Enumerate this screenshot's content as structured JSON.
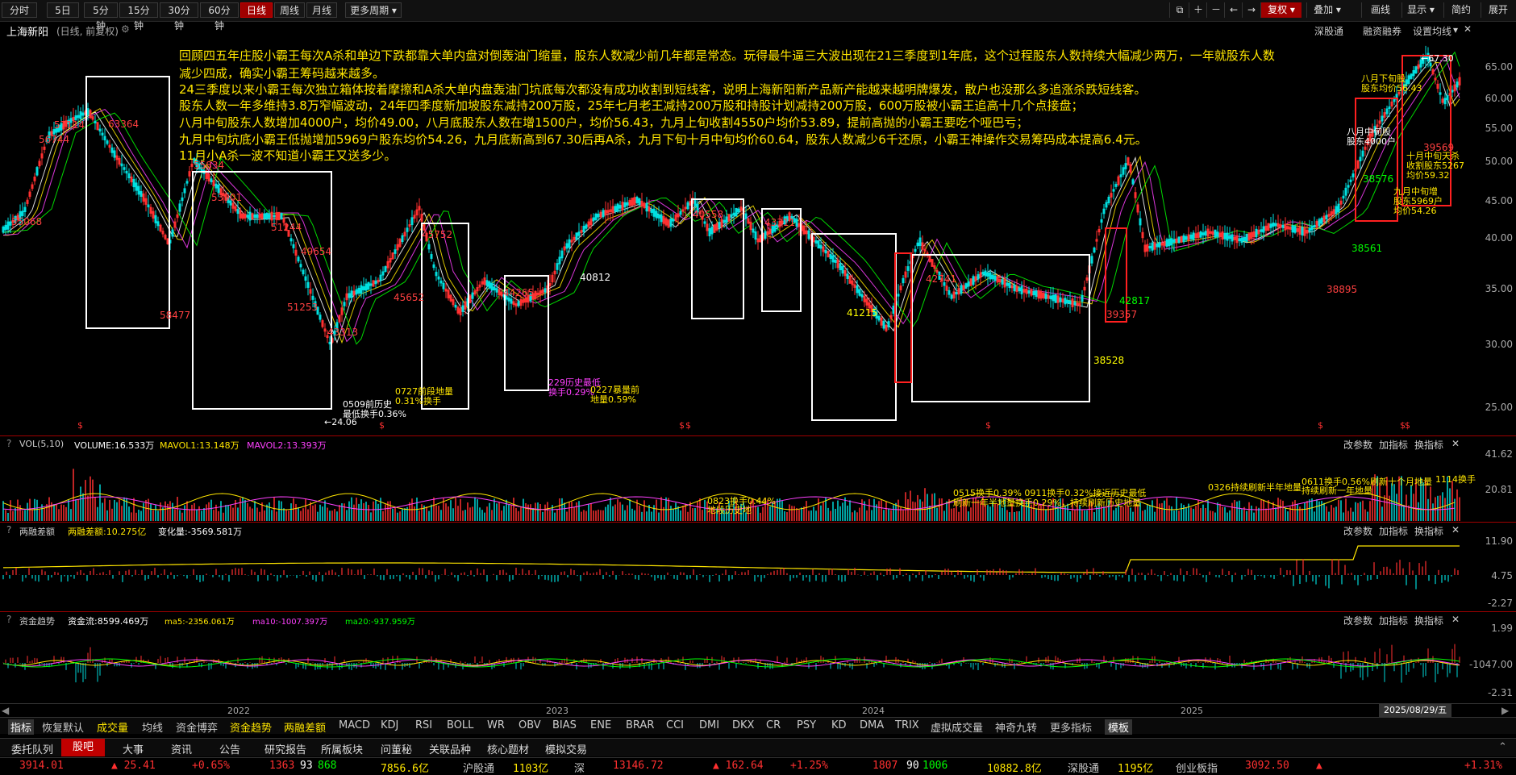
{
  "toolbar": {
    "periods": [
      "分时",
      "5日",
      "5分钟",
      "15分钟",
      "30分钟",
      "60分钟",
      "日线",
      "周线",
      "月线",
      "更多周期"
    ],
    "active_period": "日线",
    "right": [
      "复权",
      "叠加",
      "画线",
      "显示",
      "简约",
      "展开"
    ]
  },
  "stock": {
    "name": "上海新阳",
    "mode": "(日线, 前复权)",
    "right_links": [
      "深股通",
      "融资融券",
      "设置均线"
    ]
  },
  "annotations": [
    "回顾四五年庄股小霸王每次A杀和单边下跌都靠大单内盘对倒轰油门缩量，股东人数减少前几年都是常态。玩得最牛逼三大波出现在21三季度到1年底，这个过程股东人数持续大幅减少两万，一年就股东人数",
    "减少四成，确实小霸王筹码越来越多。",
    "24三季度以来小霸王每次独立箱体按着摩擦和A杀大单内盘轰油门坑底每次都没有成功收割到短线客，说明上海新阳新产品新产能越来越明牌爆发，散户也没那么多追涨杀跌短线客。",
    "股东人数一年多维持3.8万窄幅波动，24年四季度新加坡股东减持200万股，25年七月老王减持200万股和持股计划减持200万股，600万股被小霸王追高十几个点接盘；",
    "八月中旬股东人数增加4000户，均价49.00，八月底股东人数在增1500户，均价56.43，九月上旬收割4550户均价53.89，提前高抛的小霸王要吃个哑巴亏；",
    "九月中旬坑底小霸王低抛增加5969户股东均价54.26，九月底新高到67.30后再A杀，九月下旬十月中旬均价60.64，股东人数减少6千还原，小霸王神操作交易筹码成本提高6.4元。",
    "11月小A杀一波不知道小霸王又送多少。"
  ],
  "price_axis": [
    "65.00",
    "60.00",
    "55.00",
    "50.00",
    "45.00",
    "40.00",
    "35.00",
    "30.00",
    "25.00"
  ],
  "price_points": [
    {
      "t": "55068",
      "c": "#ff4040"
    },
    {
      "t": "56744",
      "c": "#ff4040"
    },
    {
      "t": "57114",
      "c": "#ff4040"
    },
    {
      "t": "63364",
      "c": "#ff4040"
    },
    {
      "t": "58477",
      "c": "#ff4040"
    },
    {
      "t": "55834",
      "c": "#ff4040"
    },
    {
      "t": "53901",
      "c": "#ff4040"
    },
    {
      "t": "51244",
      "c": "#ff4040"
    },
    {
      "t": "49654",
      "c": "#ff4040"
    },
    {
      "t": "51253",
      "c": "#ff4040"
    },
    {
      "t": "43313",
      "c": "#ff4040"
    },
    {
      "t": "45752",
      "c": "#ff4040"
    },
    {
      "t": "45652",
      "c": "#ff4040"
    },
    {
      "t": "44265",
      "c": "#ff4040"
    },
    {
      "t": "40812",
      "c": "#ffffff"
    },
    {
      "t": "40558",
      "c": "#ff4040"
    },
    {
      "t": "43311",
      "c": "#ff4040"
    },
    {
      "t": "41215",
      "c": "#ffff00"
    },
    {
      "t": "42741",
      "c": "#ff4040"
    },
    {
      "t": "38528",
      "c": "#ffff00"
    },
    {
      "t": "38561",
      "c": "#00ff00"
    },
    {
      "t": "38576",
      "c": "#00ff00"
    },
    {
      "t": "39357",
      "c": "#ff4040"
    },
    {
      "t": "42817",
      "c": "#00ff00"
    },
    {
      "t": "38895",
      "c": "#ff4040"
    },
    {
      "t": "39569",
      "c": "#ff4040"
    }
  ],
  "price_notes": [
    "0509前历史\n最低换手0.36%",
    "0727前段地量\n0.31%换手",
    "229历史最低\n换手0.29%",
    "0227暴量前\n地量0.59%",
    "←24.06",
    "八月下旬股\n股东均价56.43",
    "八月中旬股\n股东4000户",
    "十月中旬天杀\n收割股东5267\n均价59.32",
    "九月中旬增\n股东5969户\n均价54.26",
    "←67.30"
  ],
  "vol_panel": {
    "indicator": "VOL(5,10)",
    "volume": "VOLUME:16.533万",
    "mavol1": "MAVOL1:13.148万",
    "mavol2": "MAVOL2:13.393万",
    "axis": [
      "41.62",
      "20.81"
    ],
    "notes": [
      "0823换手0.44%\n地段历史地",
      "0515换手0.39% 0911换手0.32%接近历史最低\n刷新一年半地量换手0.29%，持续刷新历史地量",
      "0326持续刷新半年地量",
      "0611换手0.56%刷新十个月地量\n持续刷新一年地量",
      "1114换手"
    ]
  },
  "margin_panel": {
    "indicator": "两融差额",
    "value": "两融差额:10.275亿",
    "change": "变化量:-3569.581万",
    "axis": [
      "11.90",
      "4.75",
      "-2.27"
    ]
  },
  "flow_panel": {
    "indicator": "资金趋势",
    "value": "资金流:8599.469万",
    "ma5": "ma5:-2356.061万",
    "ma10": "ma10:-1007.397万",
    "ma20": "ma20:-937.959万",
    "axis": [
      "1.99",
      "-1047.00",
      "-2.31"
    ]
  },
  "panel_buttons": [
    "改参数",
    "加指标",
    "换指标"
  ],
  "time_axis": [
    "2022",
    "2023",
    "2024",
    "2025"
  ],
  "cursor_date": "2025/08/29/五",
  "indicator_tabs": [
    "指标",
    "恢复默认",
    "成交量",
    "均线",
    "资金博弈",
    "资金趋势",
    "两融差额",
    "MACD",
    "KDJ",
    "RSI",
    "BOLL",
    "WR",
    "OBV",
    "BIAS",
    "ENE",
    "BRAR",
    "CCI",
    "DMI",
    "DKX",
    "CR",
    "PSY",
    "KD",
    "DMA",
    "TRIX",
    "虚拟成交量",
    "神奇九转",
    "更多指标",
    "模板"
  ],
  "bottom_tabs": [
    "委托队列",
    "股吧",
    "大事",
    "资讯",
    "公告",
    "研究报告",
    "所属板块",
    "问董秘",
    "关联品种",
    "核心题材",
    "模拟交易"
  ],
  "active_bottom_tab": "股吧",
  "ticker": {
    "sh_index": "3914.01",
    "sh_chg": "▲ 25.41",
    "sh_pct": "+0.65%",
    "sh_up": "1363",
    "sh_flat": "93",
    "sh_down": "868",
    "sh_amt": "7856.6亿",
    "hgt_label": "沪股通",
    "hgt_val": "1103亿",
    "sz_label": "深",
    "sz_index": "13146.72",
    "sz_chg": "▲ 162.64",
    "sz_pct": "+1.25%",
    "sz_up": "1807",
    "sz_flat": "90",
    "sz_down": "1006",
    "sz_amt": "10882.8亿",
    "sgt_label": "深股通",
    "sgt_val": "1195亿",
    "cyb_label": "创业板指",
    "cyb_index": "3092.50",
    "cyb_pct": "+1.31%"
  },
  "colors": {
    "up": "#ff3030",
    "down": "#00ffff",
    "yellow": "#ffe600",
    "green": "#00ff00",
    "magenta": "#ff40ff",
    "active": "#c00000"
  }
}
